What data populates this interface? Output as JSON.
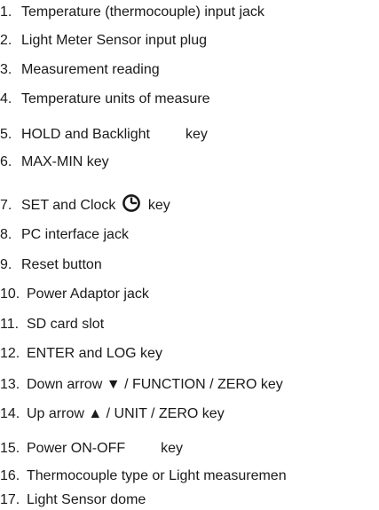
{
  "legend": [
    {
      "number": "1.",
      "text": "Temperature (thermocouple) input jack"
    },
    {
      "number": "2.",
      "text": "Light Meter Sensor input plug"
    },
    {
      "number": "3.",
      "text": "Measurement reading"
    },
    {
      "number": "4.",
      "text": "Temperature units of measure"
    },
    {
      "number": "5.",
      "text": "HOLD and Backlight",
      "suffix": "key"
    },
    {
      "number": "6.",
      "text": "MAX-MIN key"
    },
    {
      "number": "7.",
      "text": "SET and Clock",
      "suffix": "key",
      "icon": "clock-icon"
    },
    {
      "number": "8.",
      "text": "PC interface jack"
    },
    {
      "number": "9.",
      "text": "Reset button"
    },
    {
      "number": "10.",
      "text": "Power Adaptor jack"
    },
    {
      "number": "11.",
      "text": "SD card slot"
    },
    {
      "number": "12.",
      "text": "ENTER and LOG key"
    },
    {
      "number": "13.",
      "text": "Down arrow ▼ / FUNCTION / ZERO key"
    },
    {
      "number": "14.",
      "text": "Up arrow ▲ / UNIT / ZERO key"
    },
    {
      "number": "15.",
      "text": "Power ON-OFF",
      "suffix": "key"
    },
    {
      "number": "16.",
      "text": "Thermocouple type or Light measuremen"
    },
    {
      "number": "17.",
      "text": "Light Sensor dome"
    }
  ]
}
